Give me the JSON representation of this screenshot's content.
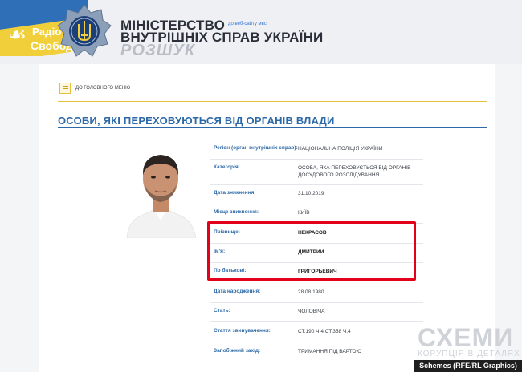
{
  "header": {
    "rfe_logo_top": "Радіо",
    "rfe_logo_bottom": "Свобода",
    "ministry_line1": "МІНІСТЕРСТВО",
    "ministry_line2": "ВНУТРІШНІХ СПРАВ УКРАЇНИ",
    "section_name": "РОЗШУК",
    "to_site_link": "до веб-сайту мвс"
  },
  "menu": {
    "back_label": "ДО ГОЛОВНОГО МЕНЮ"
  },
  "page_title": "ОСОБИ, ЯКІ ПЕРЕХОВУЮТЬСЯ ВІД ОРГАНІВ ВЛАДИ",
  "rows": [
    {
      "label": "Регіон (орган внутрішніх справ):",
      "value": "НАЦІОНАЛЬНА ПОЛІЦІЯ УКРАЇНИ"
    },
    {
      "label": "Категорія:",
      "value": "ОСОБА, ЯКА ПЕРЕХОВУЄТЬСЯ ВІД ОРГАНІВ ДОСУДОВОГО РОЗСЛІДУВАННЯ"
    },
    {
      "label": "Дата зникнення:",
      "value": "31.10.2019"
    },
    {
      "label": "Місце зникнення:",
      "value": "КИЇВ"
    },
    {
      "label": "Прізвище:",
      "value": "НЕКРАСОВ"
    },
    {
      "label": "Ім'я:",
      "value": "ДМИТРИЙ"
    },
    {
      "label": "По батькові:",
      "value": "ГРИГОРЬЕВИЧ"
    },
    {
      "label": "Дата народження:",
      "value": "28.08.1980"
    },
    {
      "label": "Стать:",
      "value": "ЧОЛОВІЧА"
    },
    {
      "label": "Стаття звинувачення:",
      "value": "СТ.190 Ч.4 СТ.358 Ч.4"
    },
    {
      "label": "Запобіжний захід:",
      "value": "ТРИМАННЯ ПІД ВАРТОЮ"
    }
  ],
  "watermark": {
    "brand": "СХЕМИ",
    "tagline": "КОРУПЦІЯ В ДЕТАЛЯХ",
    "credit": "Schemes (RFE/RL Graphics)"
  },
  "colors": {
    "accent_blue": "#2d69a8",
    "highlight_red": "#e2001a",
    "menu_gold": "#e6c13d"
  }
}
